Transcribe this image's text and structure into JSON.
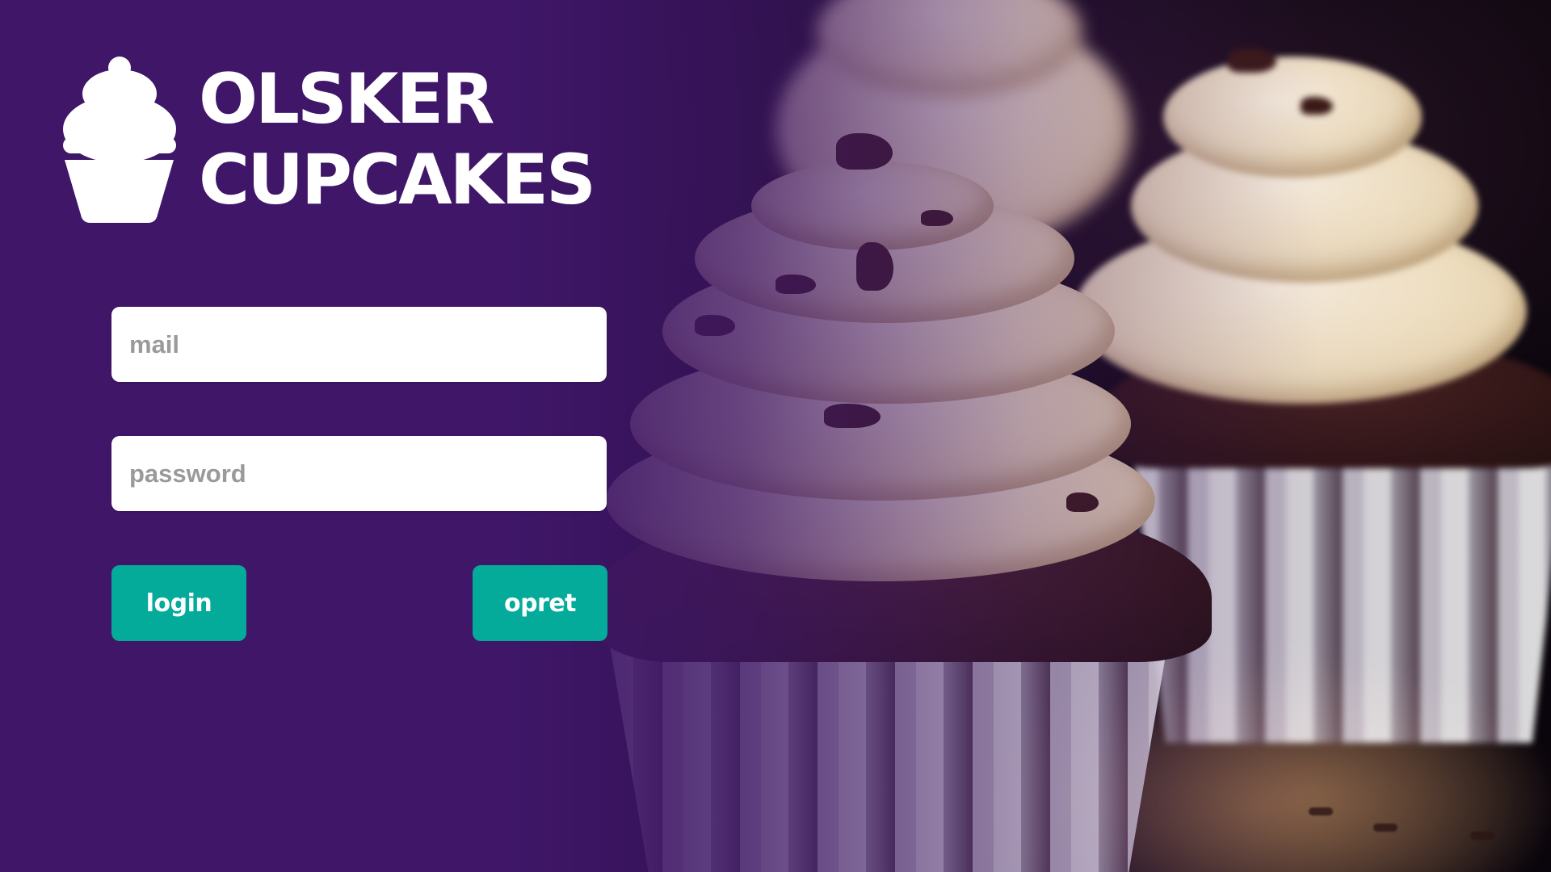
{
  "brand": {
    "line1": "OLSKER",
    "line2": "CUPCAKES",
    "icon": "cupcake-icon"
  },
  "form": {
    "mail_placeholder": "mail",
    "mail_value": "",
    "password_placeholder": "password",
    "password_value": ""
  },
  "actions": {
    "login_label": "login",
    "opret_label": "opret"
  },
  "colors": {
    "brand_purple": "#3f1668",
    "button_teal": "#04ab9b",
    "text_white": "#ffffff",
    "placeholder_gray": "#9a9a9a"
  }
}
